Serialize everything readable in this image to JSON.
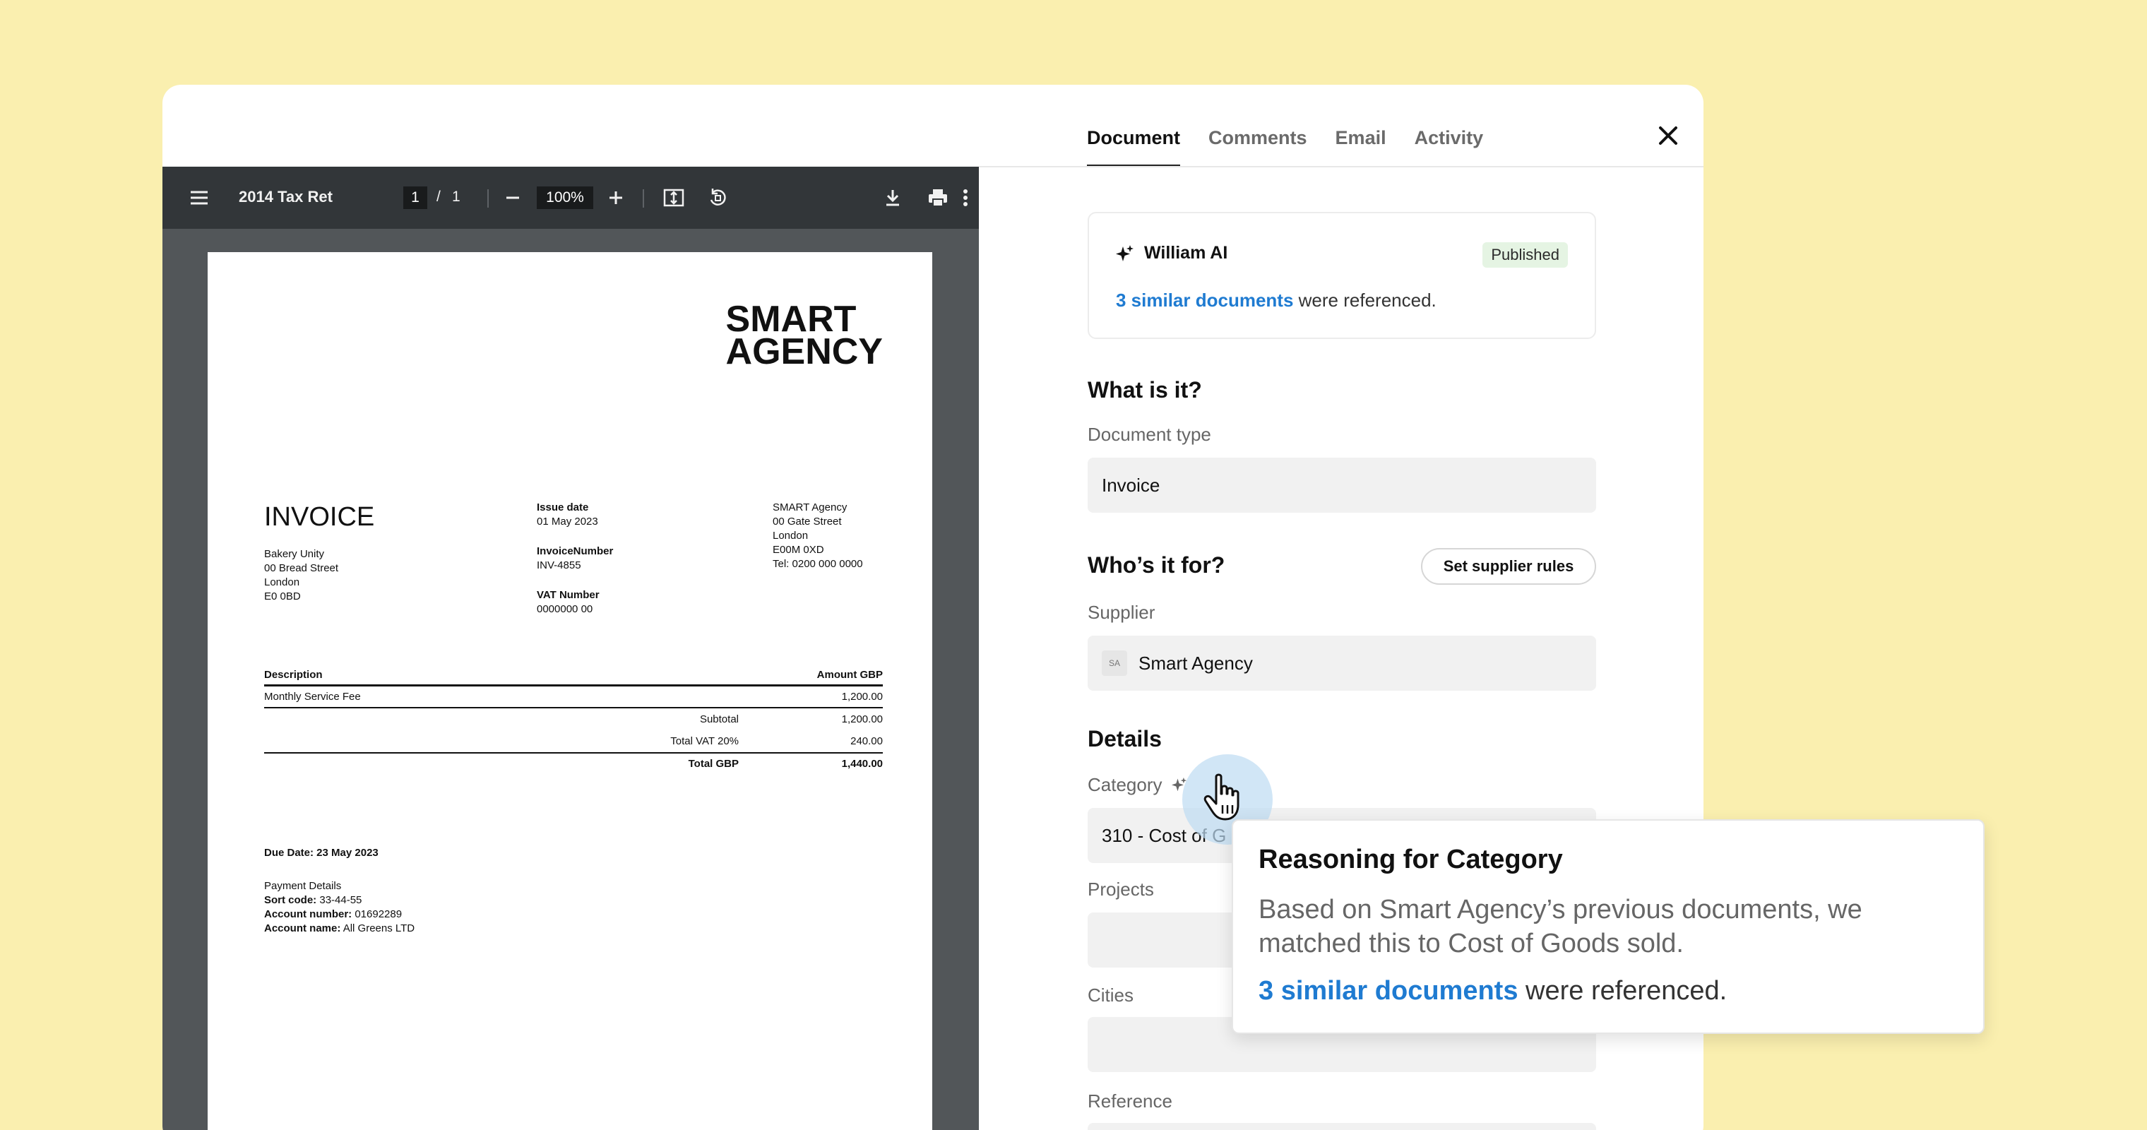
{
  "tabs": [
    "Document",
    "Comments",
    "Email",
    "Activity"
  ],
  "viewer": {
    "title": "2014 Tax Ret",
    "page_current": "1",
    "page_sep": "/",
    "page_total": "1",
    "zoom": "100%"
  },
  "invoice": {
    "logo_line1": "SMART",
    "logo_line2": "AGENCY",
    "title": "INVOICE",
    "to": [
      "Bakery Unity",
      "00 Bread Street",
      "London",
      "E0 0BD"
    ],
    "issue_date_label": "Issue date",
    "issue_date": "01 May 2023",
    "number_label": "InvoiceNumber",
    "number": "INV-4855",
    "vat_label": "VAT Number",
    "vat": "0000000 00",
    "from": [
      "SMART Agency",
      "00 Gate Street",
      "London",
      "E00M 0XD",
      "Tel: 0200 000 0000"
    ],
    "col_desc": "Description",
    "col_amount": "Amount GBP",
    "item_desc": "Monthly Service Fee",
    "item_amount": "1,200.00",
    "subtotal_label": "Subtotal",
    "subtotal": "1,200.00",
    "vat_total_label": "Total VAT 20%",
    "vat_total": "240.00",
    "total_label": "Total GBP",
    "total": "1,440.00",
    "due": "Due Date: 23 May 2023",
    "payment_title": "Payment Details",
    "sort_code_label": "Sort code:",
    "sort_code": "33-44-55",
    "account_number_label": "Account number:",
    "account_number": "01692289",
    "account_name_label": "Account name:",
    "account_name": "All Greens LTD"
  },
  "ai_card": {
    "name": "William AI",
    "status": "Published",
    "ref_link": "3 similar documents",
    "ref_text": "were referenced."
  },
  "what_is_it": {
    "heading": "What is it?",
    "doc_type_label": "Document type",
    "doc_type": "Invoice"
  },
  "whos_it_for": {
    "heading": "Who’s it for?",
    "rules_button": "Set supplier rules",
    "supplier_label": "Supplier",
    "supplier_initials": "SA",
    "supplier": "Smart Agency"
  },
  "details": {
    "heading": "Details",
    "category_label": "Category",
    "category_value": "310 - Cost of G",
    "projects_label": "Projects",
    "cities_label": "Cities",
    "reference_label": "Reference"
  },
  "tooltip": {
    "title": "Reasoning for Category",
    "body": "Based on Smart Agency’s previous documents, we matched this to Cost of Goods sold.",
    "ref_link": "3 similar documents",
    "ref_text": "were referenced."
  },
  "colors": {
    "background": "#FAEFAF",
    "link": "#1F7BD1",
    "badge": "#E5F4E3",
    "toolbar": "#323639",
    "viewer_bg": "#525659"
  },
  "icons": [
    "menu-icon",
    "minus-icon",
    "plus-icon",
    "fit-page-icon",
    "rotate-icon",
    "download-icon",
    "print-icon",
    "more-vert-icon",
    "close-icon",
    "sparkle-icon",
    "hand-cursor-icon"
  ]
}
